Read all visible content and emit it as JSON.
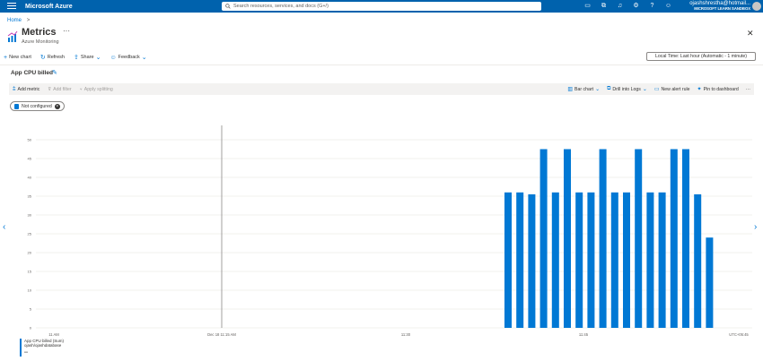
{
  "topbar": {
    "brand": "Microsoft Azure",
    "search_placeholder": "Search resources, services, and docs (G+/)",
    "account_user": "ojashshrestha@hotmail...",
    "account_tenant": "MICROSOFT LEARN SANDBOX",
    "icons": [
      "cloud-shell-icon",
      "directory-icon",
      "notifications-icon",
      "settings-icon",
      "help-icon",
      "feedback-icon"
    ]
  },
  "breadcrumb": {
    "home": "Home",
    "separator": ">"
  },
  "page": {
    "title": "Metrics",
    "more": "···",
    "subtitle": "Azure Monitoring",
    "close": "✕"
  },
  "commands": {
    "new_chart": "New chart",
    "refresh": "Refresh",
    "share": "Share",
    "feedback": "Feedback",
    "time_range": "Local Time: Last hour (Automatic - 1 minute)"
  },
  "chart_panel": {
    "title": "App CPU billed",
    "toolbar_left": {
      "add_metric": "Add metric",
      "add_filter": "Add filter",
      "apply_splitting": "Apply splitting"
    },
    "toolbar_right": {
      "bar_chart": "Bar chart",
      "drill_logs": "Drill into Logs",
      "new_alert": "New alert rule",
      "pin": "Pin to dashboard",
      "more": "···"
    },
    "filter_pill": "Not configured",
    "legend": {
      "line1": "App CPU billed (Sum)",
      "line2": "ojash/ojashdatabase",
      "value": "--"
    },
    "accent": "#0078d4"
  },
  "chart_data": {
    "type": "bar",
    "ylim": [
      0,
      50
    ],
    "yticks": [
      "0",
      "5",
      "10",
      "15",
      "20",
      "25",
      "30",
      "35",
      "40",
      "45",
      "50"
    ],
    "xtick_labels": [
      "11 AM",
      "Dec 18 11:15 AM",
      "11:30",
      "11:45",
      "UTC+05:45"
    ],
    "cursor_label": "Dec 18 11:15 AM",
    "values": [
      36,
      36,
      35.5,
      47.5,
      36,
      47.5,
      36,
      36,
      47.5,
      36,
      36,
      47.5,
      36,
      36,
      47.5,
      47.5,
      35.5,
      24
    ]
  }
}
